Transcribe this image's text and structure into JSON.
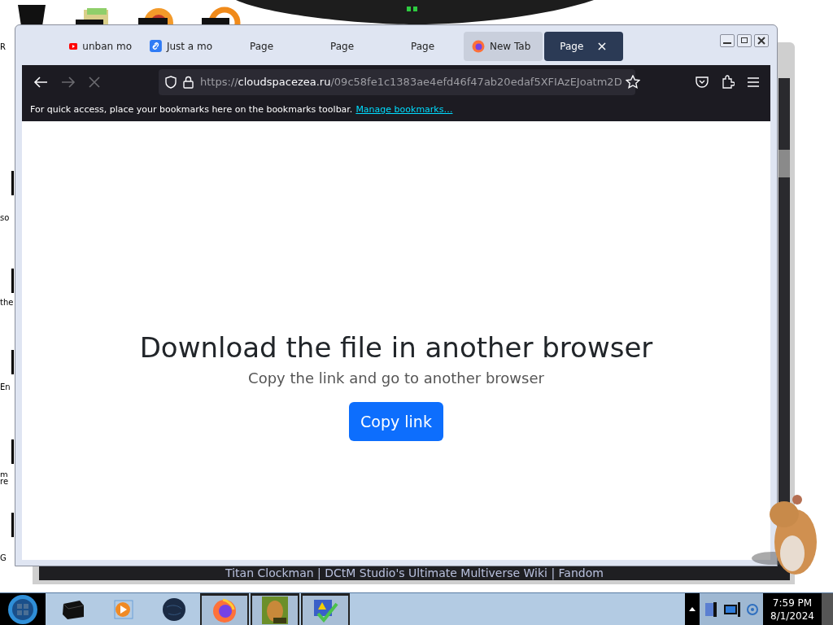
{
  "desktop": {
    "icon_labels": [
      "R",
      "so",
      "the",
      "En",
      "m",
      "re",
      "G"
    ]
  },
  "background_window": {
    "status_text": "Titan Clockman | DCtM Studio's Ultimate Multiverse Wiki | Fandom"
  },
  "browser": {
    "tabs": [
      {
        "label": "unban mo",
        "kind": "video",
        "selected": false
      },
      {
        "label": "Just a mo",
        "kind": "link",
        "selected": false
      },
      {
        "label": "Page",
        "kind": "plain",
        "selected": false
      },
      {
        "label": "Page",
        "kind": "plain",
        "selected": false
      },
      {
        "label": "Page",
        "kind": "plain",
        "selected": false
      },
      {
        "label": "New Tab",
        "kind": "newtab",
        "selected": false
      },
      {
        "label": "Page",
        "kind": "plain",
        "selected": true
      }
    ],
    "tab_close": "×",
    "url": {
      "scheme": "https://",
      "host": "cloudspacezea.ru",
      "path": "/09c58fe1c1383ae4efd46f47ab20edaf5XFIAzEJoatm2D"
    },
    "bookmarks_bar": {
      "text": "For quick access, place your bookmarks here on the bookmarks toolbar.",
      "link": "Manage bookmarks…"
    },
    "page": {
      "heading": "Download the file in another browser",
      "subtitle": "Copy the link and go to another browser",
      "button": "Copy link"
    }
  },
  "taskbar": {
    "items": [
      {
        "kind": "device",
        "selected": false
      },
      {
        "kind": "media",
        "selected": false
      },
      {
        "kind": "globe",
        "selected": false
      },
      {
        "kind": "firefox",
        "selected": true
      },
      {
        "kind": "hamster",
        "selected": true
      },
      {
        "kind": "check",
        "selected": true
      }
    ],
    "time": "7:59 PM",
    "date": "8/1/2024"
  }
}
